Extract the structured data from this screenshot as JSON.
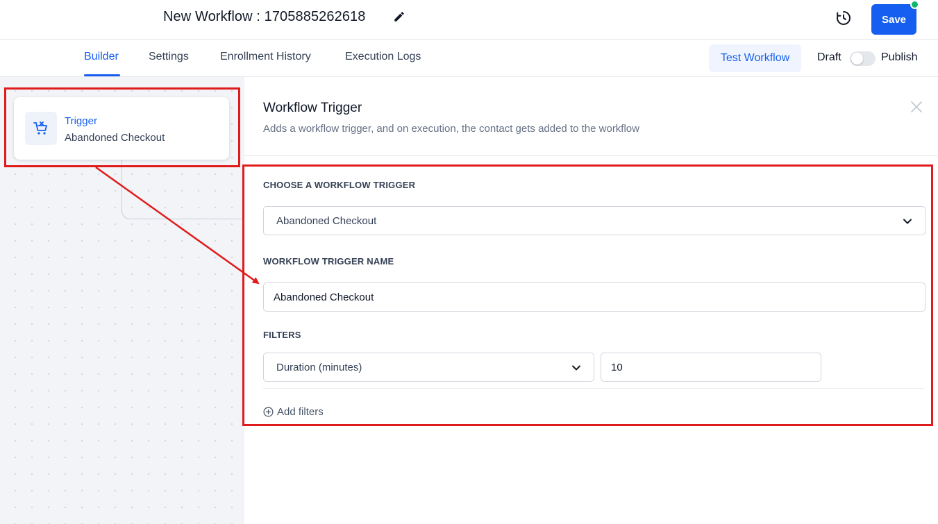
{
  "header": {
    "title": "New Workflow : 1705885262618",
    "save_label": "Save"
  },
  "tabs": [
    {
      "label": "Builder",
      "active": true
    },
    {
      "label": "Settings",
      "active": false
    },
    {
      "label": "Enrollment History",
      "active": false
    },
    {
      "label": "Execution Logs",
      "active": false
    }
  ],
  "toolbar": {
    "test_label": "Test Workflow",
    "draft_label": "Draft",
    "publish_label": "Publish",
    "published": false
  },
  "canvas": {
    "trigger_title": "Trigger",
    "trigger_subtitle": "Abandoned Checkout",
    "icon": "cart-icon"
  },
  "panel": {
    "title": "Workflow Trigger",
    "description": "Adds a workflow trigger, and on execution, the contact gets added to the workflow",
    "trigger_label": "CHOOSE A WORKFLOW TRIGGER",
    "trigger_value": "Abandoned Checkout",
    "name_label": "WORKFLOW TRIGGER NAME",
    "name_value": "Abandoned Checkout",
    "filters_label": "FILTERS",
    "filter_field": "Duration (minutes)",
    "filter_value": "10",
    "add_filters_label": "Add filters"
  },
  "colors": {
    "accent": "#155eef",
    "annotation": "#e01b1b",
    "status_dot": "#12b76a"
  }
}
